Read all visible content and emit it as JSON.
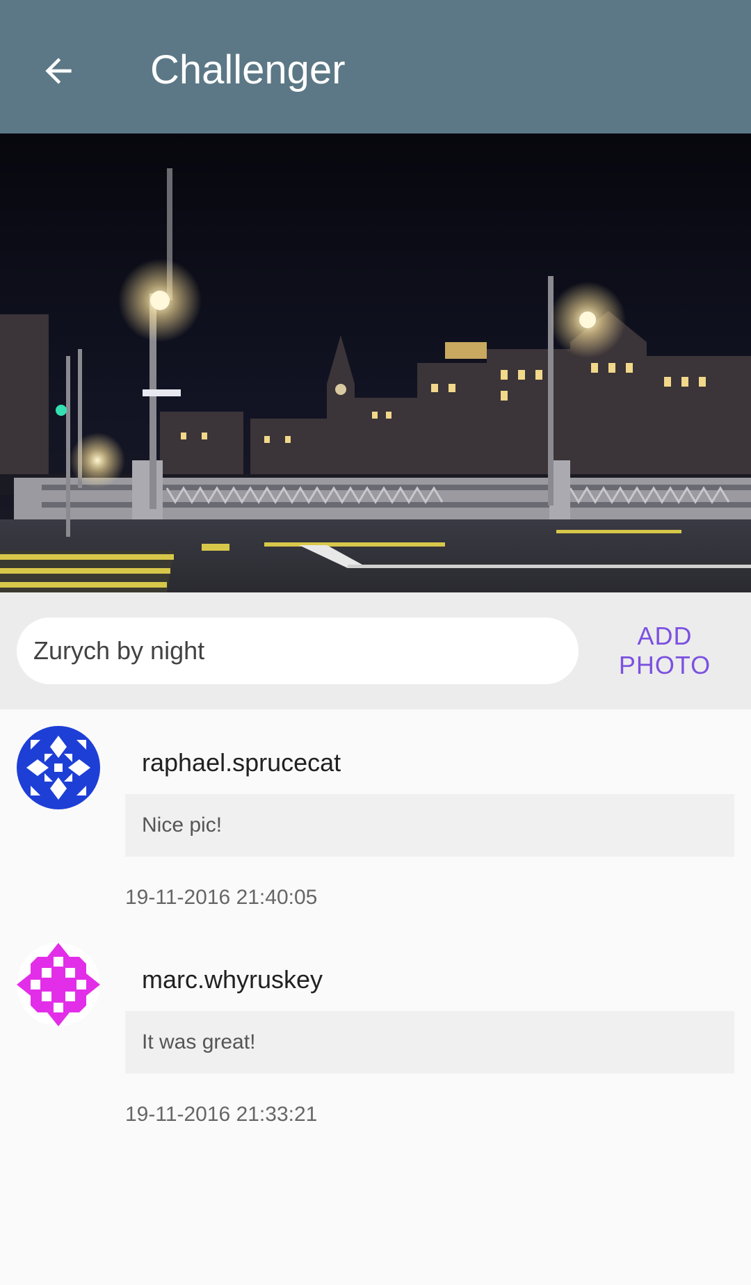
{
  "appbar": {
    "title": "Challenger",
    "back_icon": "arrow-left-icon"
  },
  "photo": {
    "description_icon": "night-city-photo"
  },
  "composer": {
    "caption_value": "Zurych by night",
    "add_photo_label": "ADD PHOTO"
  },
  "comments": [
    {
      "user": "raphael.sprucecat",
      "text": "Nice pic!",
      "timestamp": "19-11-2016 21:40:05",
      "avatar_color": "#1e3fd6"
    },
    {
      "user": "marc.whyruskey",
      "text": "It was great!",
      "timestamp": "19-11-2016 21:33:21",
      "avatar_color": "#e22ee8"
    }
  ],
  "colors": {
    "appbar": "#5c7886",
    "accent": "#7b51e0"
  }
}
